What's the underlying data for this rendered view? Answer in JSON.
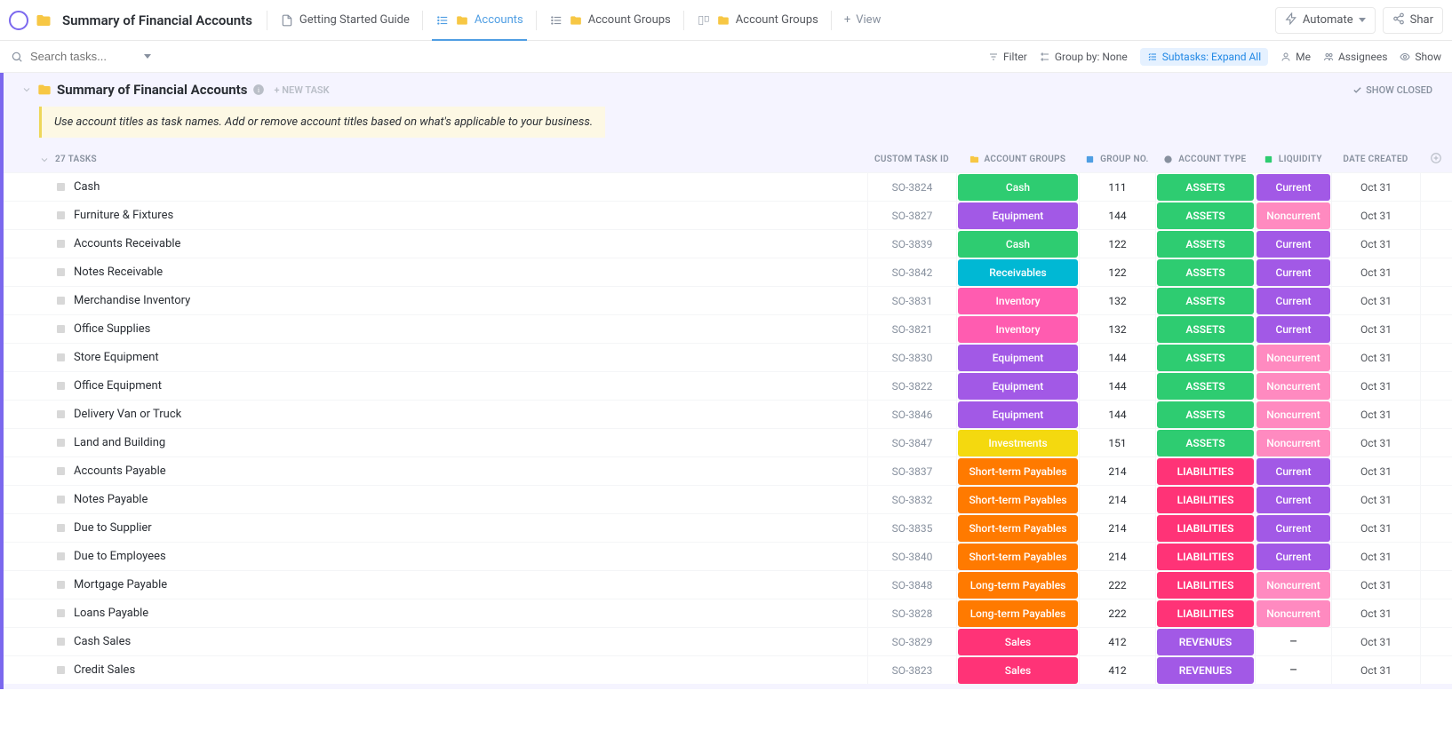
{
  "header": {
    "title": "Summary of Financial Accounts",
    "tabs": [
      {
        "label": "Getting Started Guide",
        "icon": "doc"
      },
      {
        "label": "Accounts",
        "icon": "list-folder",
        "active": true
      },
      {
        "label": "Account Groups",
        "icon": "list-folder"
      },
      {
        "label": "Account Groups",
        "icon": "board-folder"
      }
    ],
    "add_view": "View",
    "automate": "Automate",
    "share": "Shar"
  },
  "toolbar": {
    "search_placeholder": "Search tasks...",
    "filter": "Filter",
    "group_by": "Group by: None",
    "subtasks": "Subtasks: Expand All",
    "me": "Me",
    "assignees": "Assignees",
    "show": "Show"
  },
  "list": {
    "title": "Summary of Financial Accounts",
    "new_task": "+ NEW TASK",
    "show_closed": "SHOW CLOSED",
    "hint": "Use account titles as task names. Add or remove account titles based on what's applicable to your business.",
    "task_count": "27 TASKS",
    "columns": {
      "id": "CUSTOM TASK ID",
      "group": "ACCOUNT GROUPS",
      "num": "GROUP NO.",
      "type": "ACCOUNT TYPE",
      "liq": "LIQUIDITY",
      "date": "DATE CREATED"
    }
  },
  "colors": {
    "Cash": "#2ecc71",
    "Equipment": "#a259e6",
    "Receivables": "#00b8d4",
    "Inventory": "#ff5cb0",
    "Investments": "#f4d90f",
    "Short-term Payables": "#ff7a00",
    "Long-term Payables": "#ff7a00",
    "Sales": "#ff3377",
    "ASSETS": "#2ecc71",
    "LIABILITIES": "#ff3377",
    "REVENUES": "#a259e6",
    "Current": "#a259e6",
    "Noncurrent": "#ff8ac0"
  },
  "rows": [
    {
      "name": "Cash",
      "id": "SO-3824",
      "group": "Cash",
      "num": "111",
      "type": "ASSETS",
      "liq": "Current",
      "date": "Oct 31"
    },
    {
      "name": "Furniture & Fixtures",
      "id": "SO-3827",
      "group": "Equipment",
      "num": "144",
      "type": "ASSETS",
      "liq": "Noncurrent",
      "date": "Oct 31"
    },
    {
      "name": "Accounts Receivable",
      "id": "SO-3839",
      "group": "Cash",
      "num": "122",
      "type": "ASSETS",
      "liq": "Current",
      "date": "Oct 31"
    },
    {
      "name": "Notes Receivable",
      "id": "SO-3842",
      "group": "Receivables",
      "num": "122",
      "type": "ASSETS",
      "liq": "Current",
      "date": "Oct 31"
    },
    {
      "name": "Merchandise Inventory",
      "id": "SO-3831",
      "group": "Inventory",
      "num": "132",
      "type": "ASSETS",
      "liq": "Current",
      "date": "Oct 31"
    },
    {
      "name": "Office Supplies",
      "id": "SO-3821",
      "group": "Inventory",
      "num": "132",
      "type": "ASSETS",
      "liq": "Current",
      "date": "Oct 31"
    },
    {
      "name": "Store Equipment",
      "id": "SO-3830",
      "group": "Equipment",
      "num": "144",
      "type": "ASSETS",
      "liq": "Noncurrent",
      "date": "Oct 31"
    },
    {
      "name": "Office Equipment",
      "id": "SO-3822",
      "group": "Equipment",
      "num": "144",
      "type": "ASSETS",
      "liq": "Noncurrent",
      "date": "Oct 31"
    },
    {
      "name": "Delivery Van or Truck",
      "id": "SO-3846",
      "group": "Equipment",
      "num": "144",
      "type": "ASSETS",
      "liq": "Noncurrent",
      "date": "Oct 31"
    },
    {
      "name": "Land and Building",
      "id": "SO-3847",
      "group": "Investments",
      "num": "151",
      "type": "ASSETS",
      "liq": "Noncurrent",
      "date": "Oct 31"
    },
    {
      "name": "Accounts Payable",
      "id": "SO-3837",
      "group": "Short-term Payables",
      "num": "214",
      "type": "LIABILITIES",
      "liq": "Current",
      "date": "Oct 31"
    },
    {
      "name": "Notes Payable",
      "id": "SO-3832",
      "group": "Short-term Payables",
      "num": "214",
      "type": "LIABILITIES",
      "liq": "Current",
      "date": "Oct 31"
    },
    {
      "name": "Due to Supplier",
      "id": "SO-3835",
      "group": "Short-term Payables",
      "num": "214",
      "type": "LIABILITIES",
      "liq": "Current",
      "date": "Oct 31"
    },
    {
      "name": "Due to Employees",
      "id": "SO-3840",
      "group": "Short-term Payables",
      "num": "214",
      "type": "LIABILITIES",
      "liq": "Current",
      "date": "Oct 31"
    },
    {
      "name": "Mortgage Payable",
      "id": "SO-3848",
      "group": "Long-term Payables",
      "num": "222",
      "type": "LIABILITIES",
      "liq": "Noncurrent",
      "date": "Oct 31"
    },
    {
      "name": "Loans Payable",
      "id": "SO-3828",
      "group": "Long-term Payables",
      "num": "222",
      "type": "LIABILITIES",
      "liq": "Noncurrent",
      "date": "Oct 31"
    },
    {
      "name": "Cash Sales",
      "id": "SO-3829",
      "group": "Sales",
      "num": "412",
      "type": "REVENUES",
      "liq": "-",
      "date": "Oct 31"
    },
    {
      "name": "Credit Sales",
      "id": "SO-3823",
      "group": "Sales",
      "num": "412",
      "type": "REVENUES",
      "liq": "-",
      "date": "Oct 31"
    }
  ]
}
